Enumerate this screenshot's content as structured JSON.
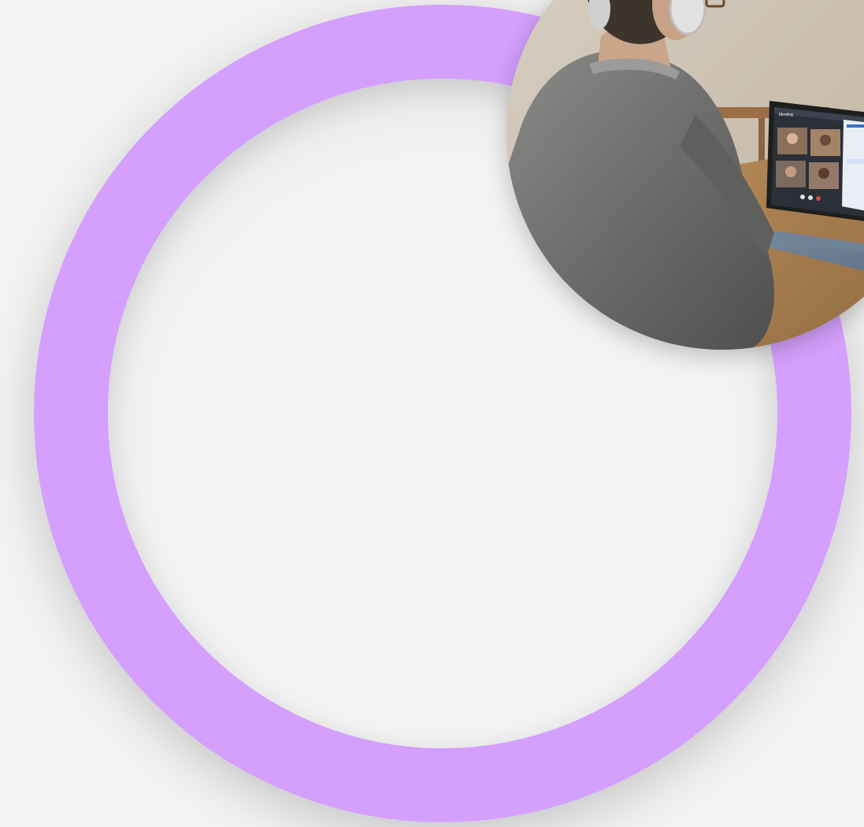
{
  "scene": {
    "background_color": "#f2f2f2",
    "ring_color": "#d49ffd",
    "photo_subject": "person-with-headphones-using-laptop-video-call",
    "laptop_screen": {
      "call_title": "Meeting"
    }
  }
}
